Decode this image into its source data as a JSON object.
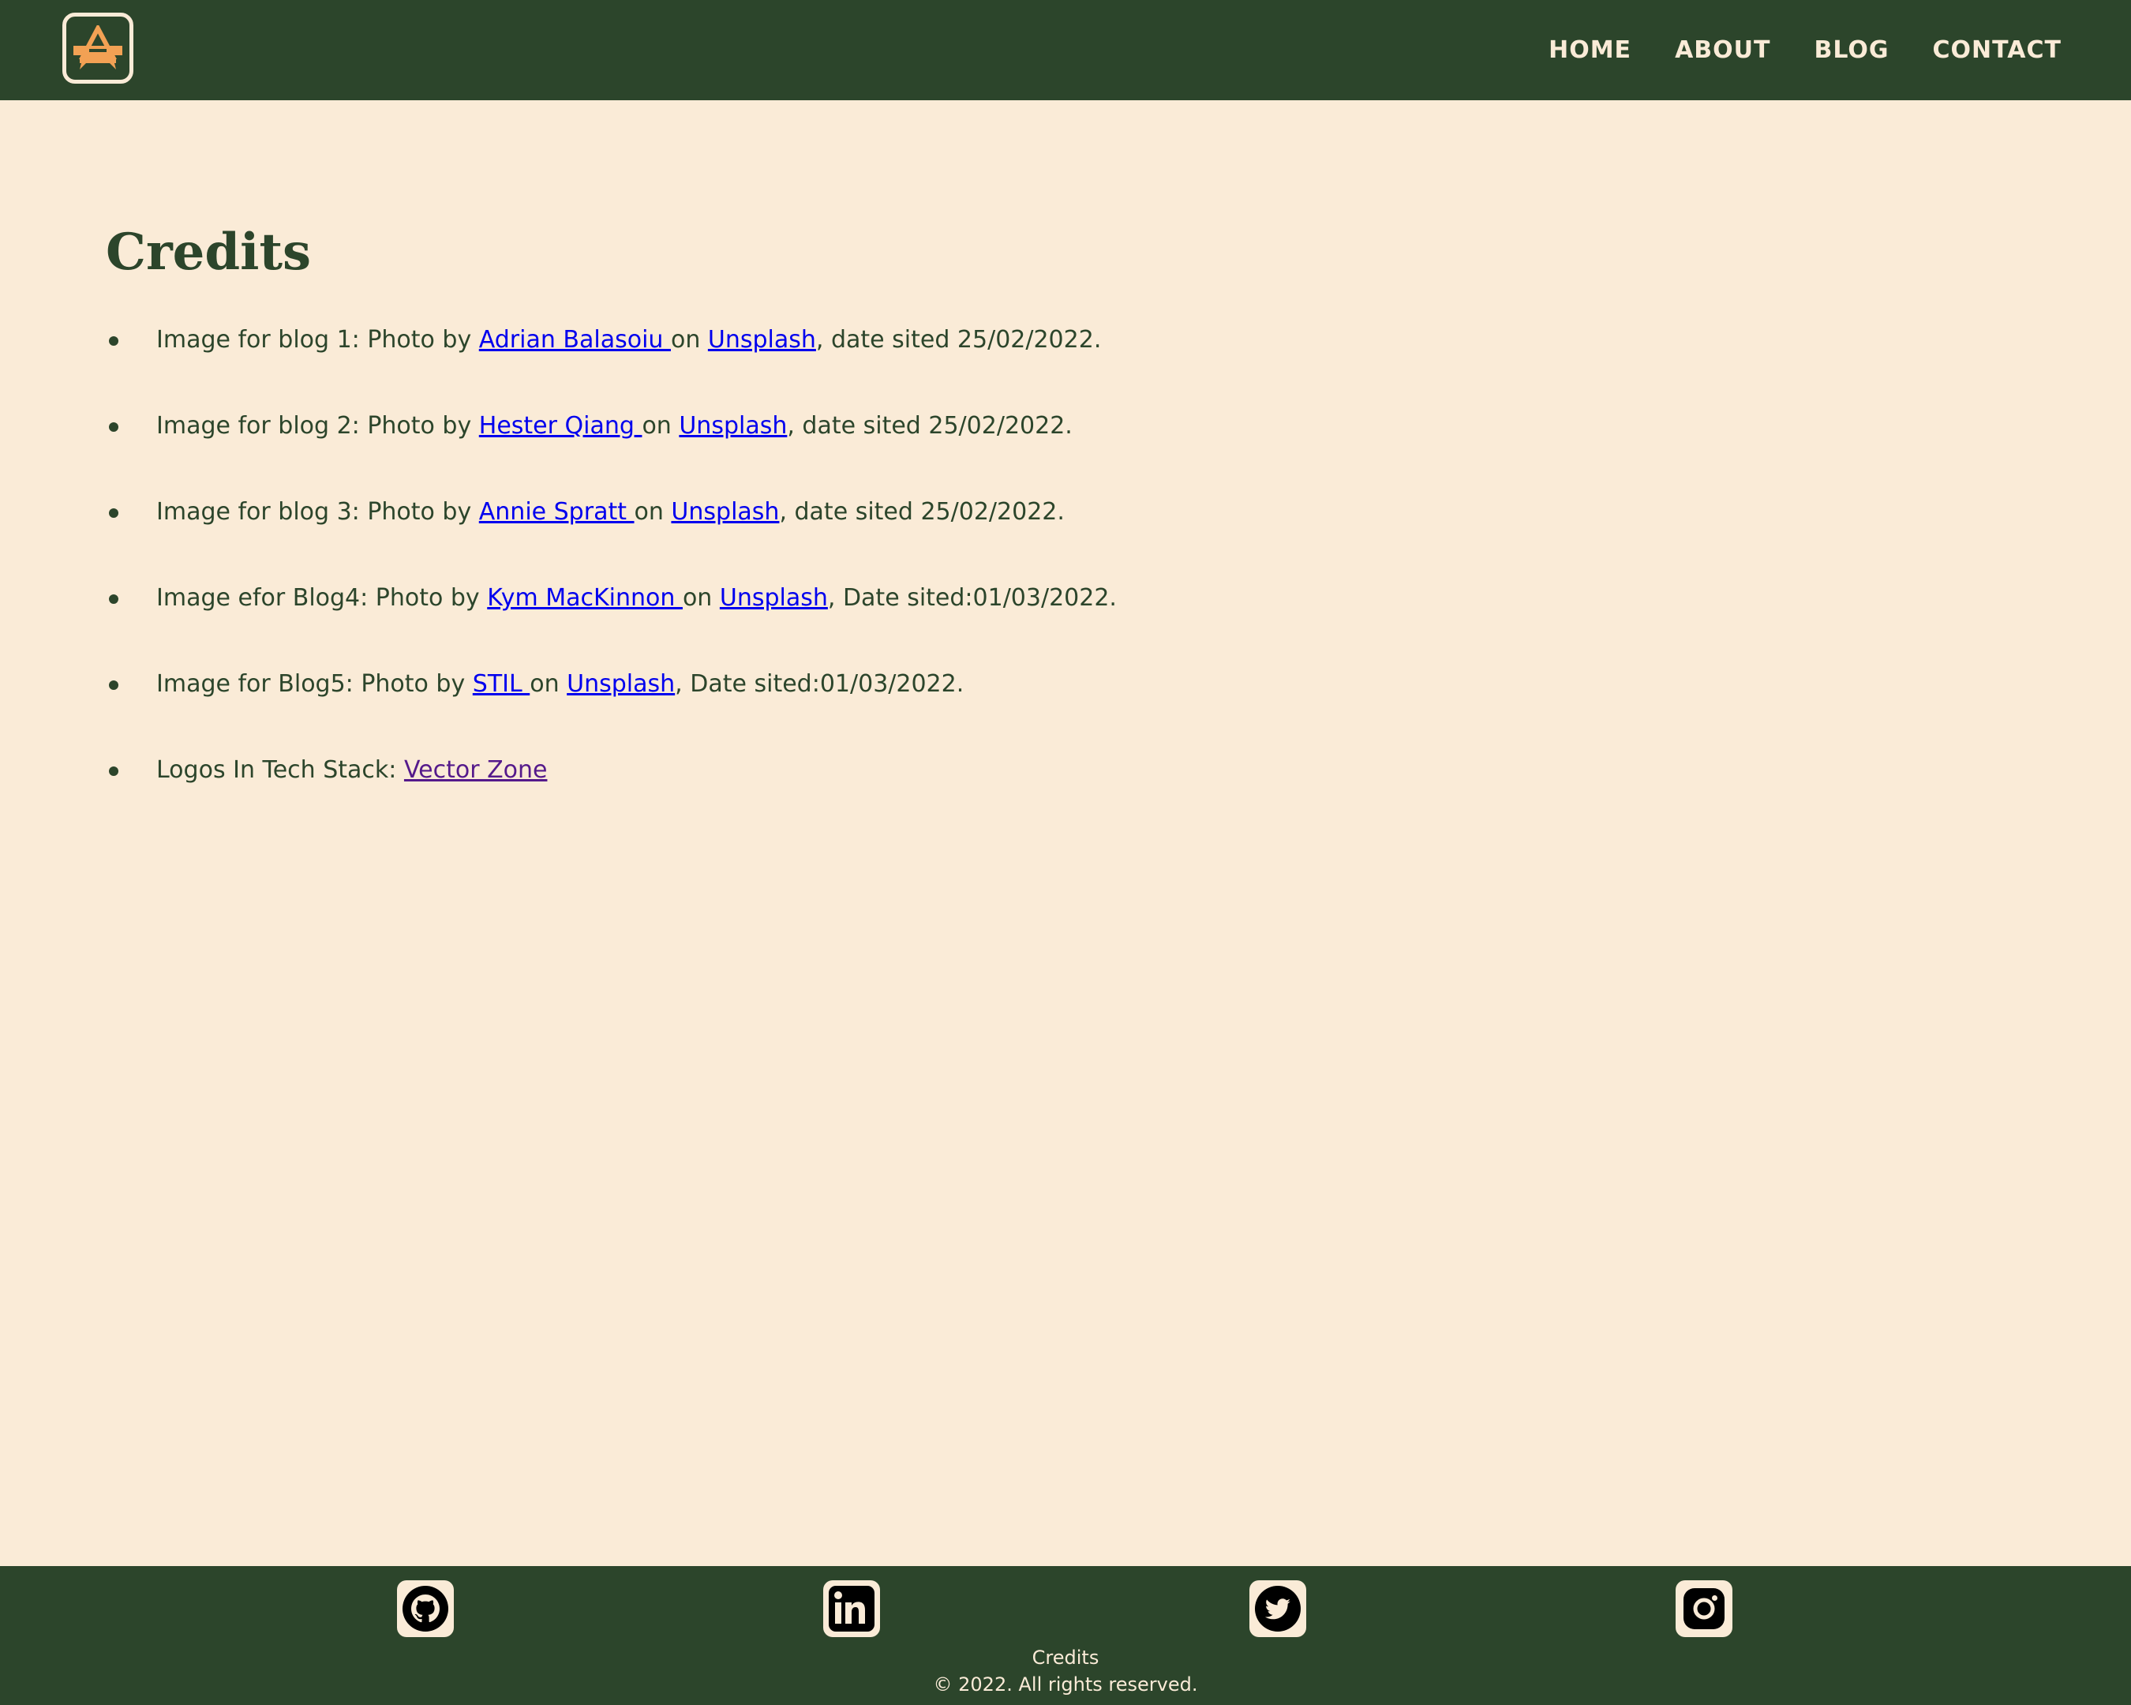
{
  "header": {
    "logo_icon": "logo-icon",
    "nav": [
      {
        "label": "HOME"
      },
      {
        "label": "ABOUT"
      },
      {
        "label": "BLOG"
      },
      {
        "label": "CONTACT"
      }
    ]
  },
  "main": {
    "title": "Credits",
    "items": [
      {
        "prefix": "Image for blog 1: Photo by ",
        "author": "Adrian Balasoiu ",
        "mid": "on ",
        "source": "Unsplash",
        "suffix": ", date sited 25/02/2022."
      },
      {
        "prefix": "Image for blog 2: Photo by ",
        "author": "Hester Qiang ",
        "mid": "on ",
        "source": "Unsplash",
        "suffix": ", date sited 25/02/2022."
      },
      {
        "prefix": "Image for blog 3: Photo by ",
        "author": "Annie Spratt ",
        "mid": "on ",
        "source": "Unsplash",
        "suffix": ", date sited 25/02/2022."
      },
      {
        "prefix": "Image efor Blog4: Photo by ",
        "author": "Kym MacKinnon ",
        "mid": "on ",
        "source": "Unsplash",
        "suffix": ", Date sited:01/03/2022."
      },
      {
        "prefix": "Image for Blog5: Photo by ",
        "author": "STIL ",
        "mid": "on ",
        "source": "Unsplash",
        "suffix": ", Date sited:01/03/2022."
      }
    ],
    "logos": {
      "prefix": "Logos In Tech Stack: ",
      "link": "Vector Zone"
    }
  },
  "footer": {
    "social": [
      {
        "icon": "github-icon"
      },
      {
        "icon": "linkedin-icon"
      },
      {
        "icon": "twitter-icon"
      },
      {
        "icon": "instagram-icon"
      }
    ],
    "link": "Credits",
    "copyright": "© 2022. All rights reserved."
  },
  "colors": {
    "primary_green": "#2c452b",
    "background_cream": "#faebd7",
    "logo_orange": "#f2a154",
    "link_blue": "#0000ee",
    "link_visited": "#551a8b"
  }
}
